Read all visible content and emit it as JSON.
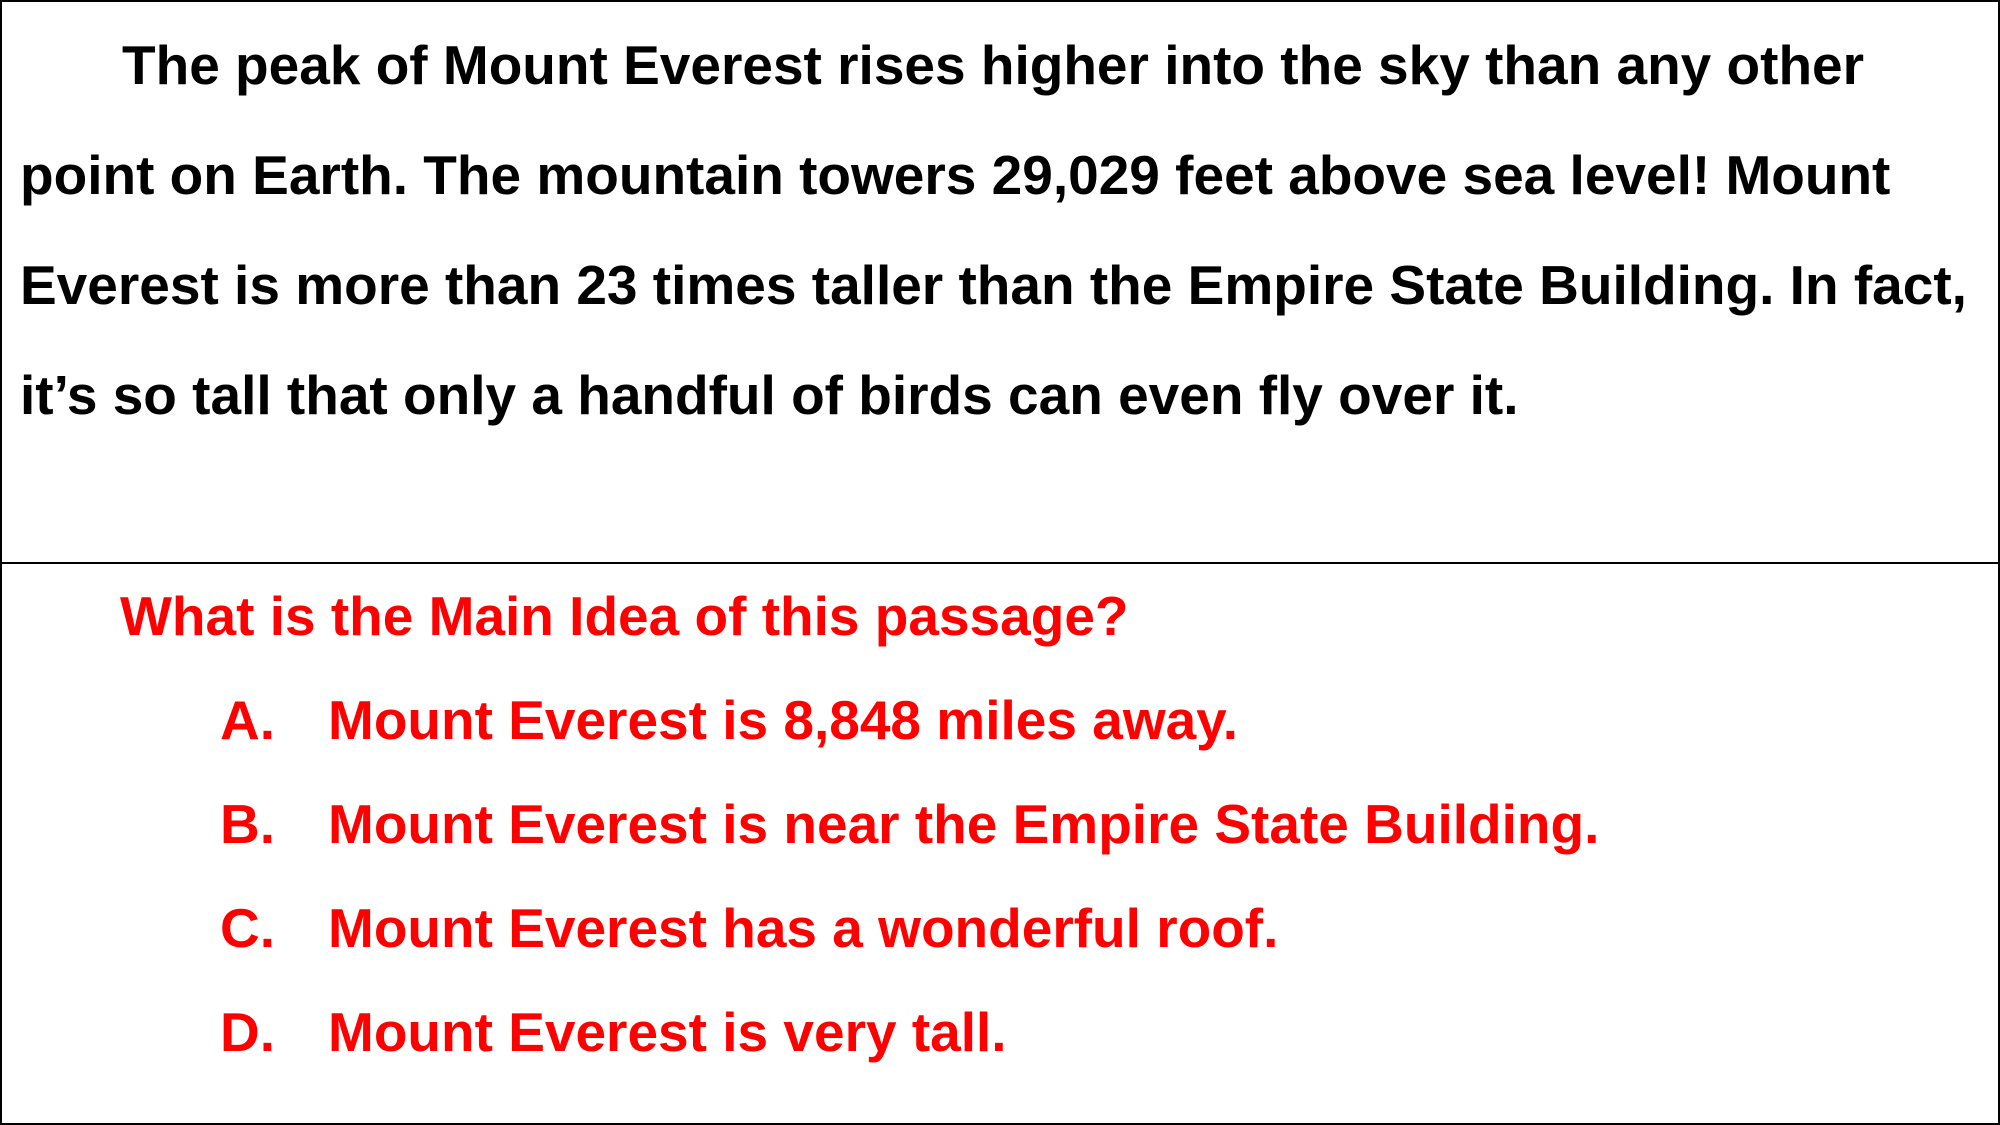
{
  "colors": {
    "passage_text": "#000000",
    "question_text": "#ff0000",
    "border": "#000000",
    "background": "#ffffff"
  },
  "passage": {
    "text": "The peak of Mount Everest rises higher into the sky than any other point on Earth.  The mountain towers 29,029 feet above sea level!  Mount Everest is more than 23 times taller than the Empire State Building.  In fact, it’s so tall that only a handful of birds can even fly over it."
  },
  "question": {
    "prompt": "What is the Main Idea of this passage?",
    "choices": [
      {
        "letter": "A.",
        "text": "Mount Everest is 8,848 miles away."
      },
      {
        "letter": "B.",
        "text": "Mount Everest is near the Empire State Building."
      },
      {
        "letter": "C.",
        "text": "Mount Everest has a wonderful roof."
      },
      {
        "letter": "D.",
        "text": "Mount Everest is very tall."
      }
    ]
  }
}
